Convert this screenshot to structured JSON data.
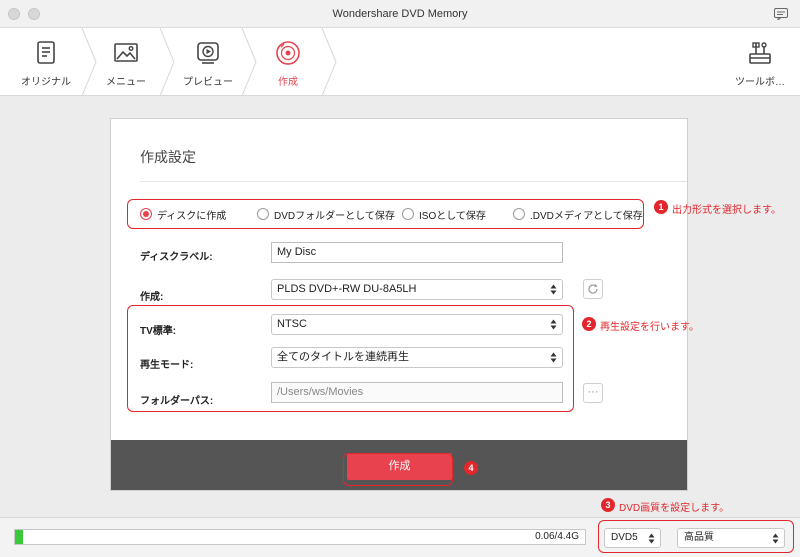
{
  "window": {
    "title": "Wondershare DVD Memory"
  },
  "nav": {
    "steps": [
      {
        "label": "オリジナル",
        "icon": "document-icon"
      },
      {
        "label": "メニュー",
        "icon": "image-icon"
      },
      {
        "label": "プレビュー",
        "icon": "play-icon"
      },
      {
        "label": "作成",
        "icon": "disc-icon",
        "active": true
      }
    ],
    "tools_label": "ツールボ…"
  },
  "dialog": {
    "title": "作成設定",
    "output_options": [
      {
        "label": "ディスクに作成",
        "checked": true
      },
      {
        "label": "DVDフォルダーとして保存",
        "checked": false
      },
      {
        "label": "ISOとして保存",
        "checked": false
      },
      {
        "label": ".DVDメディアとして保存",
        "checked": false
      }
    ],
    "disc_label": {
      "label": "ディスクラベル:",
      "value": "My Disc"
    },
    "burner": {
      "label": "作成:",
      "value": "PLDS DVD+-RW DU-8A5LH"
    },
    "tv_standard": {
      "label": "TV標準:",
      "value": "NTSC"
    },
    "playback_mode": {
      "label": "再生モード:",
      "value": "全てのタイトルを連続再生"
    },
    "folder_path": {
      "label": "フォルダーパス:",
      "value": "/Users/ws/Movies",
      "browse": "···"
    },
    "burn_button": "作成"
  },
  "annotations": {
    "badge1": "1",
    "note1": "出力形式を選択します。",
    "badge2": "2",
    "note2": "再生設定を行います。",
    "badge3": "3",
    "note3": "DVD画質を設定します。",
    "badge4": "4"
  },
  "status": {
    "progress_text": "0.06/4.4G",
    "progress_fraction": 0.0136,
    "disc_type": "DVD5",
    "quality": "高品質"
  },
  "colors": {
    "accent": "#e8424e",
    "annotation": "#e3262b",
    "progress": "#3cc83c",
    "bottom_bar": "#555555"
  }
}
